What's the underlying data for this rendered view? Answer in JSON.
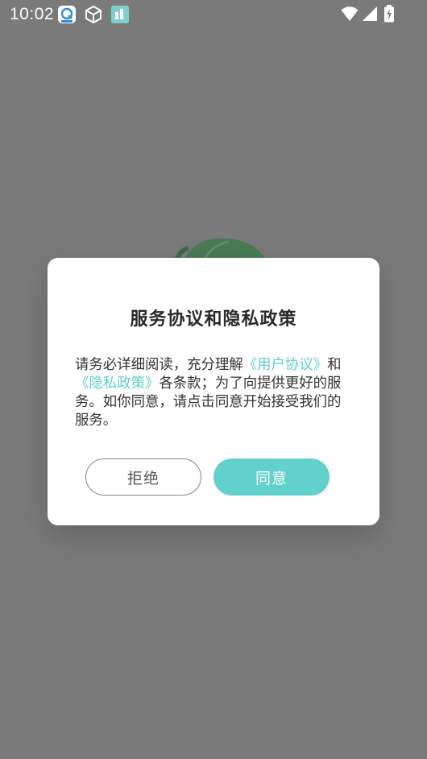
{
  "status_bar": {
    "time": "10:02",
    "icons": [
      "app-notification-icon",
      "package-icon",
      "app-tile-icon"
    ],
    "right_icons": [
      "wifi-icon",
      "cell-signal-icon",
      "battery-charging-icon"
    ]
  },
  "dialog": {
    "title": "服务协议和隐私政策",
    "body": {
      "part1": "请务必详细阅读，充分理解",
      "link_user_agreement": "《用户协议》",
      "part2": "和",
      "link_privacy_policy": "《隐私政策》",
      "part3": "各条款；为了向提供更好的服务。如你同意，请点击同意开始接受我们的服务。"
    },
    "reject_label": "拒绝",
    "agree_label": "同意"
  },
  "colors": {
    "accent": "#62d1cd",
    "link": "#5ecfcc",
    "overlay": "#7a7a7a"
  }
}
